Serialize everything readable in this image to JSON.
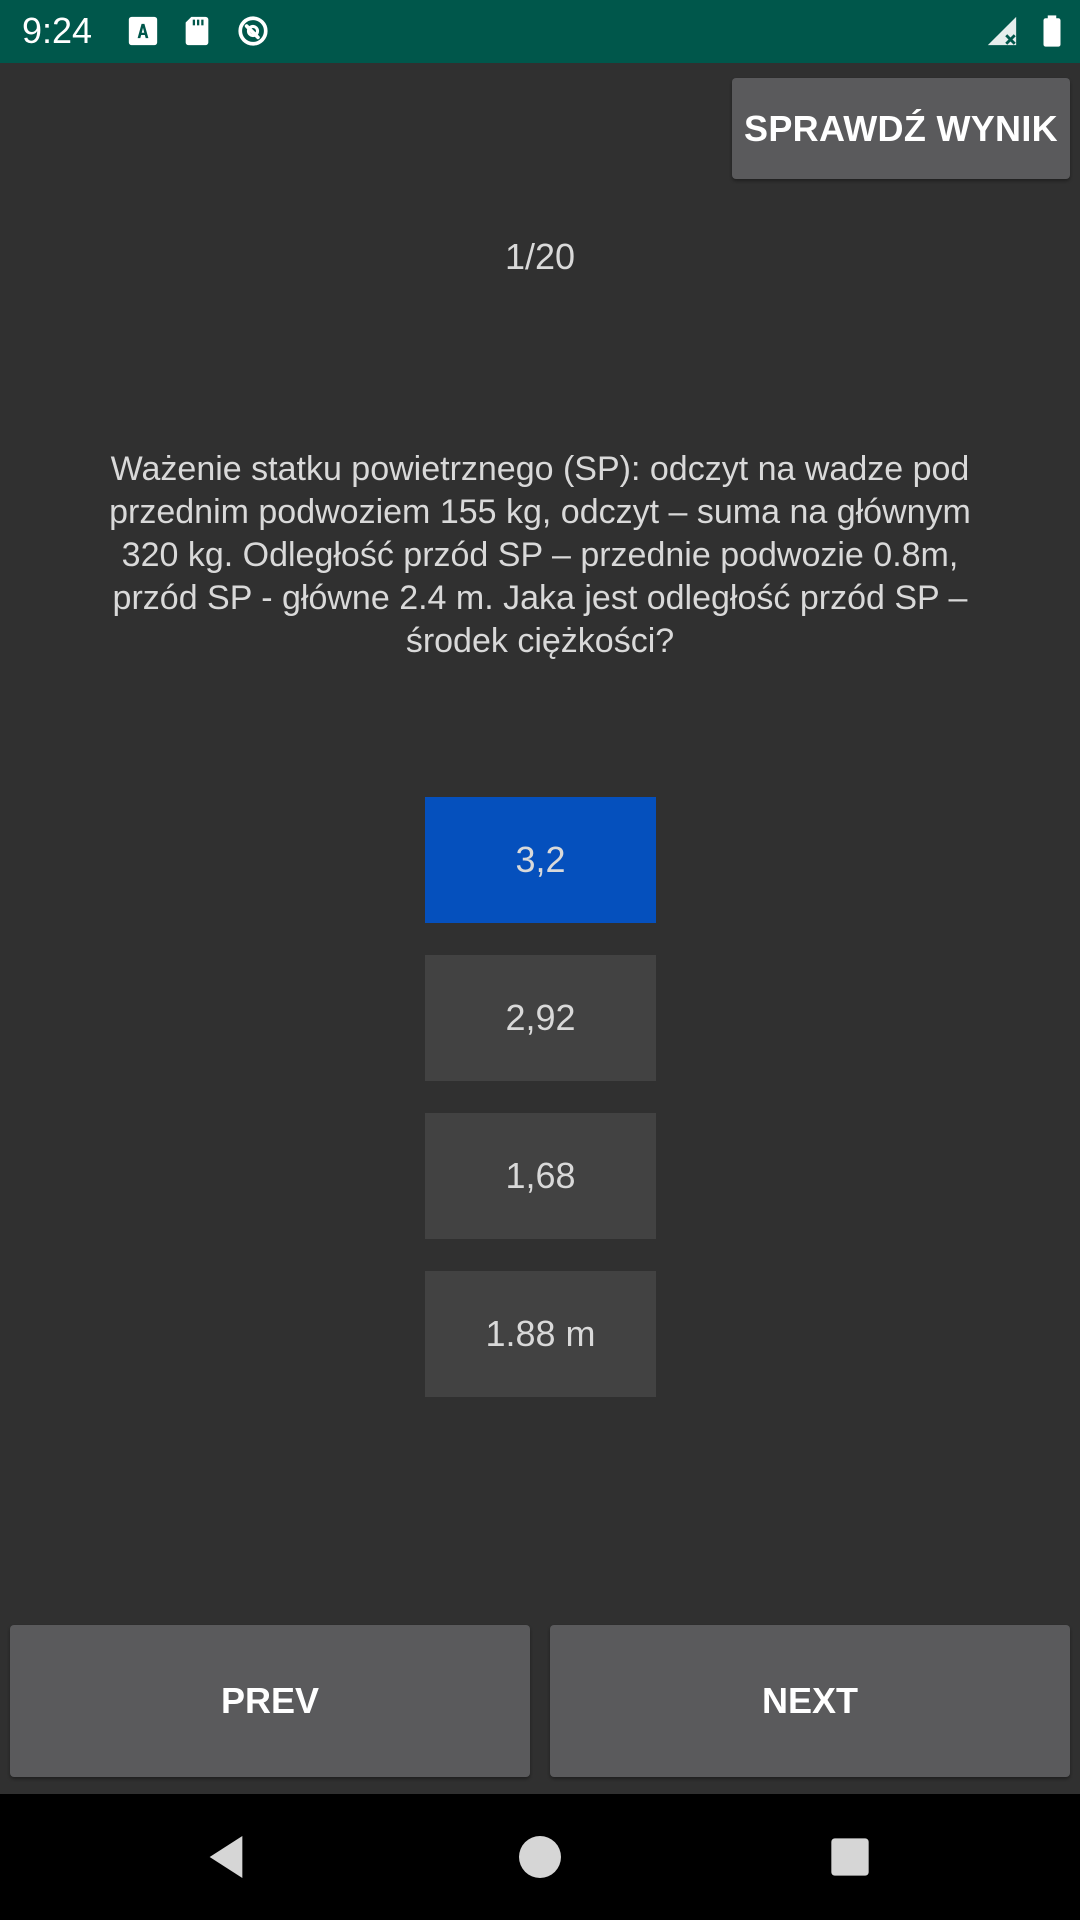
{
  "status_bar": {
    "time": "9:24",
    "colors": {
      "background": "#00574b"
    },
    "left_icons": [
      "font-download-icon",
      "sd-card-icon",
      "sync-circle-icon"
    ],
    "right_icons": [
      "signal-no-data-icon",
      "battery-icon"
    ]
  },
  "header": {
    "check_result_label": "SPRAWDŹ WYNIK"
  },
  "quiz": {
    "counter": "1/20",
    "question": "Ważenie statku powietrznego (SP): odczyt na wadze pod przednim podwoziem 155 kg, odczyt – suma na głównym 320 kg. Odległość przód SP – przednie podwozie 0.8m, przód SP - główne 2.4 m. Jaka jest odległość przód SP – środek ciężkości?",
    "answers": [
      {
        "label": "3,2",
        "selected": true
      },
      {
        "label": "2,92",
        "selected": false
      },
      {
        "label": "1,68",
        "selected": false
      },
      {
        "label": "1.88 m",
        "selected": false
      }
    ],
    "colors": {
      "selected_answer": "#0550bd",
      "answer": "#424242"
    }
  },
  "footer": {
    "prev_label": "PREV",
    "next_label": "NEXT"
  },
  "system_nav": {
    "buttons": [
      "back-icon",
      "home-icon",
      "recents-icon"
    ]
  }
}
